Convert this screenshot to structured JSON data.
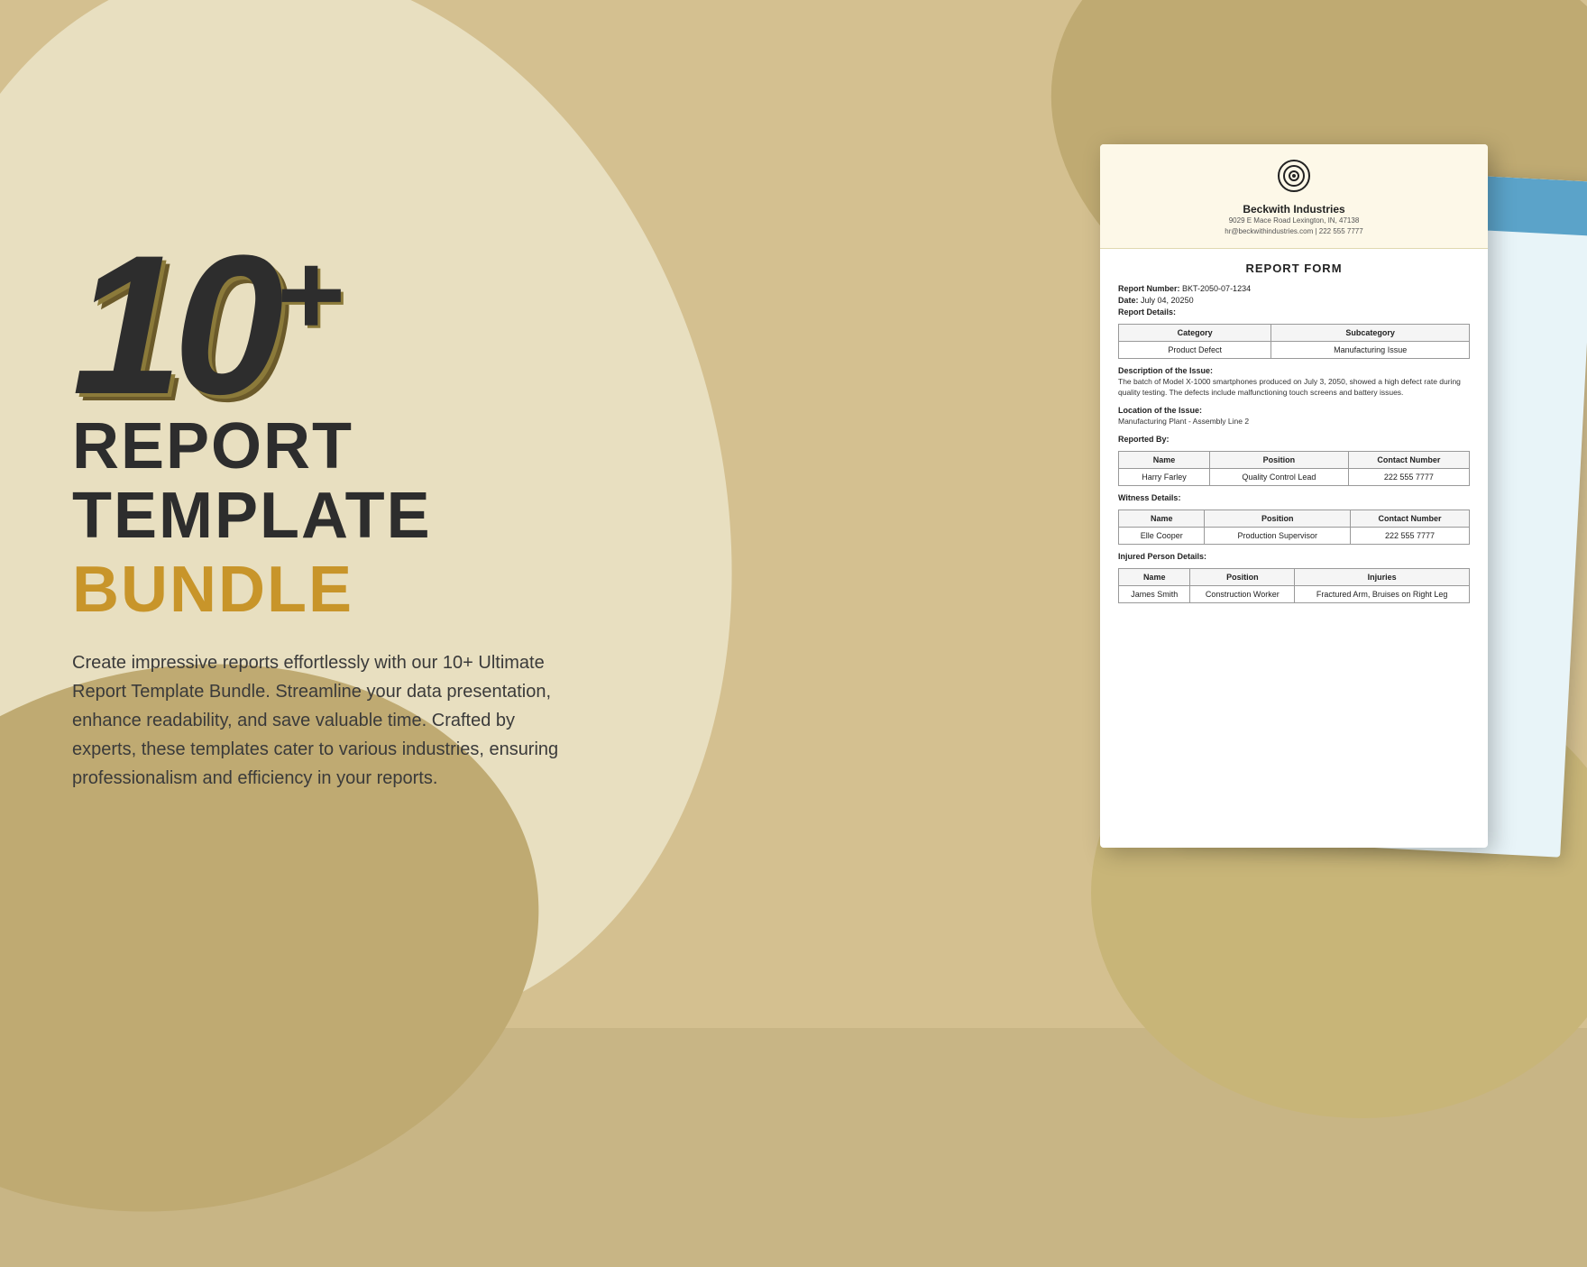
{
  "background": {
    "color": "#d4c090"
  },
  "hero": {
    "number": "10",
    "plus": "+",
    "line1": "REPORT",
    "line2": "TEMPLATE",
    "line3": "BUNDLE",
    "description": "Create impressive reports effortlessly with our 10+ Ultimate Report Template Bundle. Streamline your data presentation, enhance readability, and save valuable time. Crafted by experts, these templates cater to various industries, ensuring professionalism and efficiency in your reports."
  },
  "document": {
    "company": {
      "name": "Beckwith Industries",
      "address": "9029 E Mace Road Lexington, IN, 47138",
      "contact": "hr@beckwithindustries.com | 222 555 7777"
    },
    "title": "REPORT FORM",
    "report_number_label": "Report Number:",
    "report_number_value": "BKT-2050-07-1234",
    "date_label": "Date:",
    "date_value": "July 04, 20250",
    "report_details_label": "Report Details:",
    "table1": {
      "headers": [
        "Category",
        "Subcategory"
      ],
      "rows": [
        [
          "Product Defect",
          "Manufacturing Issue"
        ]
      ]
    },
    "description_label": "Description of the Issue:",
    "description_text": "The batch of Model X-1000 smartphones produced on July 3, 2050, showed a high defect rate during quality testing. The defects include malfunctioning touch screens and battery issues.",
    "location_label": "Location of the Issue:",
    "location_text": "Manufacturing Plant - Assembly Line 2",
    "reported_by_label": "Reported By:",
    "table2": {
      "headers": [
        "Name",
        "Position",
        "Contact Number"
      ],
      "rows": [
        [
          "Harry Farley",
          "Quality Control Lead",
          "222 555 7777"
        ]
      ]
    },
    "witness_label": "Witness Details:",
    "table3": {
      "headers": [
        "Name",
        "Position",
        "Contact Number"
      ],
      "rows": [
        [
          "Elle Cooper",
          "Production Supervisor",
          "222 555 7777"
        ]
      ]
    },
    "injured_label": "Injured Person Details:",
    "table4": {
      "headers": [
        "Name",
        "Position",
        "Injuries"
      ],
      "rows": [
        [
          "James Smith",
          "Construction Worker",
          "Fractured Arm, Bruises on Right Leg"
        ]
      ]
    }
  }
}
